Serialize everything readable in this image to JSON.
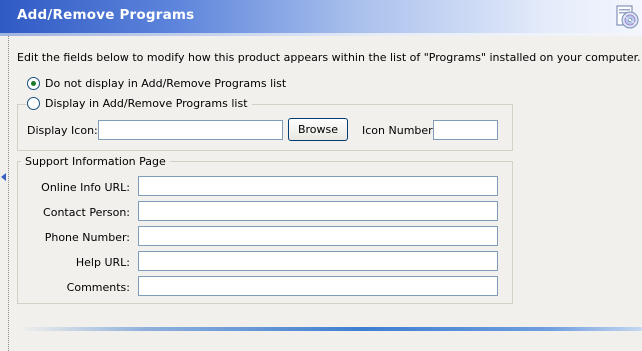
{
  "header": {
    "title": "Add/Remove Programs",
    "icon": "cd-install-icon"
  },
  "description": "Edit the fields below to modify how this product appears within the list of \"Programs\" installed on your computer.",
  "display_options": {
    "selected": "do-not-display",
    "options": [
      {
        "id": "do-not-display",
        "label": "Do not display in Add/Remove Programs list",
        "checked": true
      },
      {
        "id": "display",
        "label": "Display in Add/Remove Programs list",
        "checked": false
      }
    ]
  },
  "display_group": {
    "display_icon_label": "Display Icon:",
    "display_icon_value": "",
    "browse_label": "Browse",
    "icon_number_label": "Icon Number:",
    "icon_number_value": ""
  },
  "support_group": {
    "title": "Support Information Page",
    "fields": [
      {
        "label": "Online Info URL:",
        "value": ""
      },
      {
        "label": "Contact Person:",
        "value": ""
      },
      {
        "label": "Phone Number:",
        "value": ""
      },
      {
        "label": "Help URL:",
        "value": ""
      },
      {
        "label": "Comments:",
        "value": ""
      }
    ]
  },
  "colors": {
    "header_start": "#2f5ac4",
    "header_end": "#f3f6fc",
    "accent_line": "#3f7ed1",
    "radio_checked": "#1c7a2a"
  }
}
